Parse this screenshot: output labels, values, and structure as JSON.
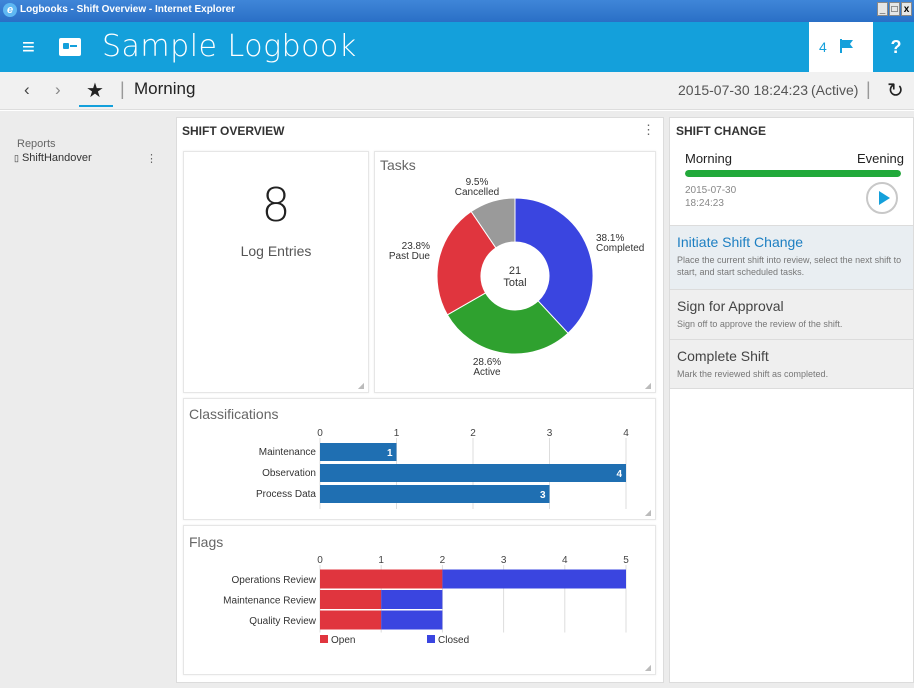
{
  "window": {
    "title": "Logbooks - Shift Overview - Internet Explorer",
    "controls": [
      "_",
      "□",
      "x"
    ]
  },
  "header": {
    "app_title": "Sample Logbook",
    "flag_count": "4",
    "help_label": "?",
    "menu_icon": "hamburger-icon",
    "logbook_icon": "logbook-icon",
    "accent_color": "#14a0db"
  },
  "nav": {
    "back": "‹",
    "forward": "›",
    "shift_name": "Morning",
    "datetime": "2015-07-30 18:24:23",
    "status": "(Active)",
    "separator": "|"
  },
  "sidebar": {
    "section_label": "Reports",
    "items": [
      {
        "label": "ShiftHandover"
      }
    ]
  },
  "overview": {
    "title": "SHIFT OVERVIEW",
    "log_entries": {
      "count": "8",
      "label": "Log Entries"
    },
    "tasks": {
      "title": "Tasks",
      "total_value": "21",
      "total_label": "Total"
    },
    "classifications": {
      "title": "Classifications"
    },
    "flags": {
      "title": "Flags"
    }
  },
  "chart_data": [
    {
      "type": "pie",
      "title": "Tasks",
      "categories": [
        "Completed",
        "Active",
        "Past Due",
        "Cancelled"
      ],
      "values": [
        38.1,
        28.6,
        23.8,
        9.5
      ],
      "value_labels": [
        "38.1%",
        "28.6%",
        "23.8%",
        "9.5%"
      ],
      "colors": [
        "#3a45e0",
        "#2fa12f",
        "#e0353e",
        "#9a9a9a"
      ],
      "center_text": [
        "21",
        "Total"
      ]
    },
    {
      "type": "bar",
      "title": "Classifications",
      "orientation": "horizontal",
      "categories": [
        "Maintenance",
        "Observation",
        "Process Data"
      ],
      "values": [
        1,
        4,
        3
      ],
      "xlim": [
        0,
        4
      ],
      "ticks": [
        "0",
        "1",
        "2",
        "3",
        "4"
      ],
      "color": "#1f6fb2"
    },
    {
      "type": "bar",
      "title": "Flags",
      "orientation": "horizontal",
      "stacked": true,
      "categories": [
        "Operations Review",
        "Maintenance Review",
        "Quality Review"
      ],
      "series": [
        {
          "name": "Open",
          "values": [
            2,
            1,
            1
          ],
          "color": "#e0353e"
        },
        {
          "name": "Closed",
          "values": [
            3,
            1,
            1
          ],
          "color": "#3a45e0"
        }
      ],
      "xlim": [
        0,
        5
      ],
      "ticks": [
        "0",
        "1",
        "2",
        "3",
        "4",
        "5"
      ],
      "legend": "bottom"
    }
  ],
  "shift_change": {
    "title": "SHIFT CHANGE",
    "from_shift": "Morning",
    "to_shift": "Evening",
    "progress_fraction": 1.0,
    "date": "2015-07-30",
    "time": "18:24:23",
    "progress_color": "#21a93a",
    "actions": [
      {
        "title": "Initiate Shift Change",
        "desc": "Place the current shift into review, select the next shift to start, and start scheduled tasks."
      },
      {
        "title": "Sign for Approval",
        "desc": "Sign off to approve the review of the shift."
      },
      {
        "title": "Complete Shift",
        "desc": "Mark the reviewed shift as completed."
      }
    ]
  }
}
